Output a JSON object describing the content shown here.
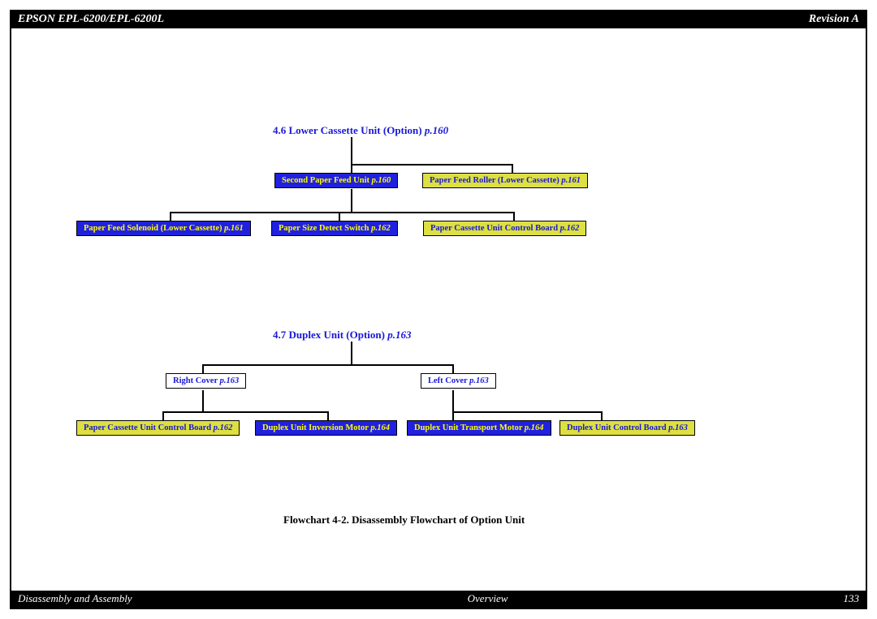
{
  "header": {
    "left": "EPSON EPL-6200/EPL-6200L",
    "right": "Revision A"
  },
  "footer": {
    "left": "Disassembly and Assembly",
    "center": "Overview",
    "right": "133"
  },
  "caption": "Flowchart 4-2.  Disassembly Flowchart of Option Unit",
  "chart_data": [
    {
      "id": "diagram1",
      "title": {
        "num": "4.6",
        "name": "Lower Cassette Unit (Option)",
        "page": "p.160"
      },
      "nodes": [
        {
          "id": "n1",
          "name": "Second Paper Feed Unit",
          "page": "p.160",
          "color": "blue",
          "parent": "root"
        },
        {
          "id": "n2",
          "name": "Paper Feed Roller (Lower Cassette)",
          "page": "p.161",
          "color": "yellow",
          "parent": "root"
        },
        {
          "id": "n3",
          "name": "Paper Feed Solenoid (Lower Cassette)",
          "page": "p.161",
          "color": "blue",
          "parent": "n1"
        },
        {
          "id": "n4",
          "name": "Paper Size Detect Switch",
          "page": "p.162",
          "color": "blue",
          "parent": "n1"
        },
        {
          "id": "n5",
          "name": "Paper Cassette Unit Control Board",
          "page": "p.162",
          "color": "yellow",
          "parent": "n1"
        }
      ]
    },
    {
      "id": "diagram2",
      "title": {
        "num": "4.7",
        "name": "Duplex Unit (Option)",
        "page": "p.163"
      },
      "nodes": [
        {
          "id": "m1",
          "name": "Right Cover",
          "page": "p.163",
          "color": "white",
          "parent": "root"
        },
        {
          "id": "m2",
          "name": "Left Cover",
          "page": "p.163",
          "color": "white",
          "parent": "root"
        },
        {
          "id": "m3",
          "name": "Paper Cassette Unit Control Board",
          "page": "p.162",
          "color": "yellow",
          "parent": "m1"
        },
        {
          "id": "m4",
          "name": "Duplex Unit Inversion Motor",
          "page": "p.164",
          "color": "blue",
          "parent": "m1"
        },
        {
          "id": "m5",
          "name": "Duplex Unit Transport Motor",
          "page": "p.164",
          "color": "blue",
          "parent": "m2"
        },
        {
          "id": "m6",
          "name": "Duplex Unit Control Board",
          "page": "p.163",
          "color": "yellow",
          "parent": "m2"
        }
      ]
    }
  ],
  "boxes": {
    "n1": {
      "name": "Second Paper Feed Unit",
      "page": "p.160"
    },
    "n2": {
      "name": "Paper Feed Roller (Lower Cassette)",
      "page": "p.161"
    },
    "n3": {
      "name": "Paper Feed Solenoid (Lower Cassette)",
      "page": "p.161"
    },
    "n4": {
      "name": "Paper Size Detect Switch",
      "page": "p.162"
    },
    "n5": {
      "name": "Paper Cassette Unit Control Board",
      "page": "p.162"
    },
    "m1": {
      "name": "Right Cover",
      "page": "p.163"
    },
    "m2": {
      "name": "Left Cover",
      "page": "p.163"
    },
    "m3": {
      "name": "Paper Cassette Unit Control Board",
      "page": "p.162"
    },
    "m4": {
      "name": "Duplex Unit Inversion Motor",
      "page": "p.164"
    },
    "m5": {
      "name": "Duplex Unit Transport Motor",
      "page": "p.164"
    },
    "m6": {
      "name": "Duplex Unit Control Board",
      "page": "p.163"
    }
  },
  "headings": {
    "h1": {
      "num": "4.6",
      "name": "Lower Cassette Unit (Option)",
      "page": "p.160"
    },
    "h2": {
      "num": "4.7",
      "name": "Duplex Unit (Option)",
      "page": "p.163"
    }
  }
}
